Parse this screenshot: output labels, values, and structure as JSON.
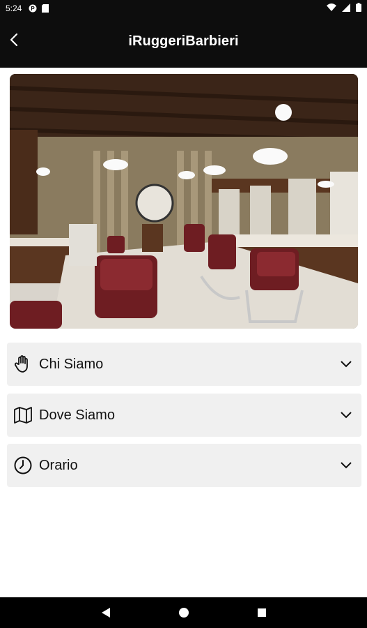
{
  "status_bar": {
    "time": "5:24",
    "icons_left": [
      "app-notification-icon",
      "sd-card-icon"
    ],
    "icons_right": [
      "wifi-icon",
      "signal-icon",
      "battery-icon"
    ]
  },
  "app_bar": {
    "title": "iRuggeriBarbieri",
    "back_icon": "arrow-back-icon"
  },
  "hero_image": {
    "description_icon": "barbershop-photo"
  },
  "sections": [
    {
      "label": "Chi Siamo",
      "icon": "hand-icon"
    },
    {
      "label": "Dove Siamo",
      "icon": "map-icon"
    },
    {
      "label": "Orario",
      "icon": "clock-icon"
    }
  ],
  "nav_bar": {
    "back": "triangle-back-icon",
    "home": "circle-home-icon",
    "recents": "square-recents-icon"
  },
  "colors": {
    "bar_background": "#0d0d0d",
    "accordion_background": "#f0f0f0",
    "text": "#111111"
  }
}
